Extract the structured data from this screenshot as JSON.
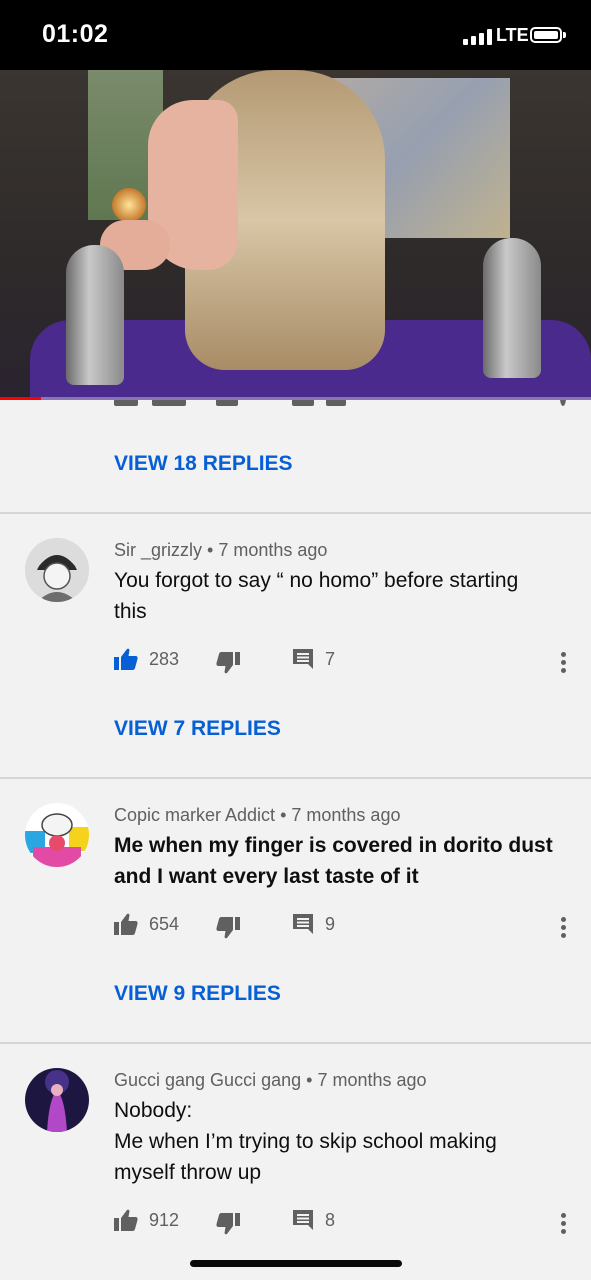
{
  "status_bar": {
    "time": "01:02",
    "network": "LTE"
  },
  "video": {
    "progress_fraction": 0.07
  },
  "previous_thread": {
    "view_replies": "VIEW 18 REPLIES"
  },
  "comments": [
    {
      "author": "Sir _grizzly",
      "age": "7 months ago",
      "lines": [
        "You forgot to say “ no homo” before starting",
        "this"
      ],
      "likes": "283",
      "replies": "7",
      "liked": true,
      "view_replies": "VIEW 7 REPLIES"
    },
    {
      "author": "Copic marker Addict",
      "age": "7 months ago",
      "lines": [
        "Me when my finger is covered in dorito dust",
        "and I want every last taste of it"
      ],
      "likes": "654",
      "replies": "9",
      "liked": false,
      "view_replies": "VIEW 9 REPLIES"
    },
    {
      "author": "Gucci gang Gucci gang",
      "age": "7 months ago",
      "lines": [
        "Nobody:",
        "Me when I’m trying to skip school making",
        "myself throw up"
      ],
      "likes": "912",
      "replies": "8",
      "liked": false
    }
  ],
  "colors": {
    "link": "#065fd4",
    "liked_thumb": "#065fd4",
    "secondary_text": "#606060",
    "progress": "#ff0000"
  },
  "icons": [
    "signal-icon",
    "battery-icon",
    "thumb-up-icon",
    "thumb-down-icon",
    "reply-comment-icon",
    "more-vert-icon"
  ]
}
